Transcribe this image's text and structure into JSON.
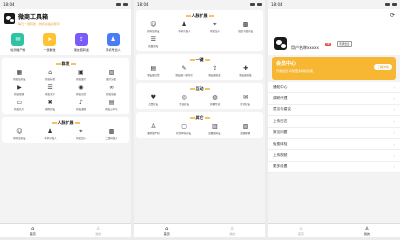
{
  "status": {
    "time": "18:04"
  },
  "colors": {
    "accent": "#f7b733",
    "vip_bg": "#f7b733",
    "feature_colors": [
      "#2ec3a3",
      "#ffc234",
      "#7a5af8",
      "#4a7cf7"
    ]
  },
  "home": {
    "app_title": "微商工具箱",
    "app_subtitle": "每日一键转发 · 微商必备好帮手",
    "features": [
      {
        "label": "检测僵尸粉",
        "icon": "chat-icon"
      },
      {
        "label": "一键群发",
        "icon": "send-icon"
      },
      {
        "label": "朋友圈转发",
        "icon": "share-icon"
      },
      {
        "label": "手机号加人",
        "icon": "user-add-icon"
      }
    ],
    "wechat_section": {
      "title": "群发",
      "items": [
        {
          "label": "群发加好友",
          "icon": "grid-icon"
        },
        {
          "label": "群发标签",
          "icon": "tag-icon"
        },
        {
          "label": "群发图片",
          "icon": "image-icon"
        },
        {
          "label": "图片分发",
          "icon": "photo-icon"
        },
        {
          "label": "群发视频",
          "icon": "video-icon"
        },
        {
          "label": "群发文字",
          "icon": "doc-icon"
        },
        {
          "label": "群发语音",
          "icon": "mic-icon"
        },
        {
          "label": "群发链接",
          "icon": "link-icon"
        },
        {
          "label": "群发名片",
          "icon": "card-icon"
        },
        {
          "label": "删除好友",
          "icon": "trash-icon"
        },
        {
          "label": "群发通知",
          "icon": "bell-icon"
        },
        {
          "label": "群发公众号",
          "icon": "apps-icon"
        }
      ]
    },
    "add_section": {
      "title": "人脉扩展",
      "items": [
        {
          "label": "群内加好友",
          "icon": "people-icon"
        },
        {
          "label": "手机号加人",
          "icon": "user-icon"
        },
        {
          "label": "附近加人",
          "icon": "pin-icon"
        },
        {
          "label": "二维码加人",
          "icon": "qr-icon"
        }
      ]
    }
  },
  "middle": {
    "add_section": {
      "title": "人脉扩展",
      "items": [
        {
          "label": "群内加好友",
          "icon": "people-icon"
        },
        {
          "label": "手机号加人",
          "icon": "user-icon"
        },
        {
          "label": "附近加人",
          "icon": "pin-icon"
        },
        {
          "label": "微信号加好友",
          "icon": "qr-icon"
        },
        {
          "label": "批量添加",
          "icon": "list-icon"
        }
      ]
    },
    "moments_section": {
      "title": "一键",
      "items": [
        {
          "label": "朋友圈点赞",
          "icon": "note-icon"
        },
        {
          "label": "朋友圈一键评论",
          "icon": "comment-icon"
        },
        {
          "label": "朋友圈转发",
          "icon": "share-icon"
        },
        {
          "label": "朋友圈采集",
          "icon": "collect-icon"
        }
      ]
    },
    "interact_section": {
      "title": "互动",
      "items": [
        {
          "label": "点赞好友",
          "icon": "like-icon"
        },
        {
          "label": "互动好友",
          "icon": "globe-icon"
        },
        {
          "label": "群聊互动",
          "icon": "group-icon"
        },
        {
          "label": "评论好友",
          "icon": "chat-icon"
        }
      ]
    },
    "other_section": {
      "title": "其它",
      "items": [
        {
          "label": "删除僵尸粉",
          "icon": "person-icon"
        },
        {
          "label": "检测单向好友",
          "icon": "scan-icon"
        },
        {
          "label": "批量删好友",
          "icon": "delete-icon"
        },
        {
          "label": "清理群聊",
          "icon": "clean-icon"
        }
      ]
    }
  },
  "profile": {
    "username": "用户名称xxxxx",
    "badge_vip": "VIP",
    "badge_level": "普通会员",
    "vip_title": "会员中心",
    "vip_subtitle": "开通会员,享受更多特权功能",
    "vip_button": "了解详情",
    "menu": [
      "通知中心",
      "调研代理",
      "意见与建议",
      "上传日志",
      "常见问题",
      "免费体验",
      "上传视频",
      "更多设置"
    ]
  },
  "tabs": [
    {
      "label": "首页",
      "icon": "home-icon"
    },
    {
      "label": "我的",
      "icon": "user-icon"
    }
  ]
}
